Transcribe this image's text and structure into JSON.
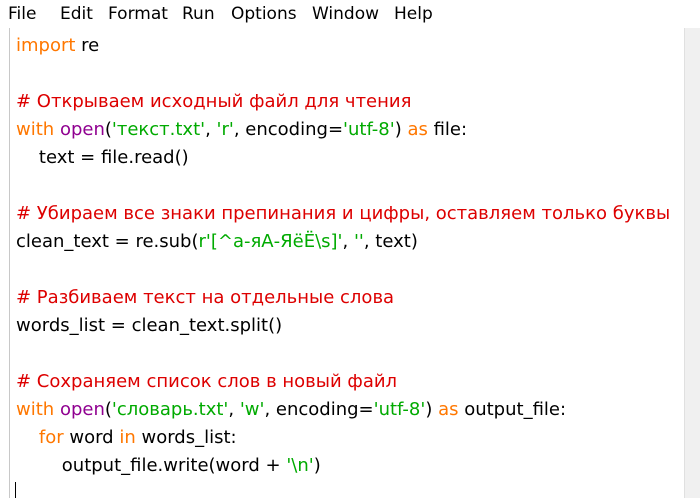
{
  "menu": {
    "items": [
      "File",
      "Edit",
      "Format",
      "Run",
      "Options",
      "Window",
      "Help"
    ]
  },
  "editor": {
    "lines": [
      {
        "tokens": [
          {
            "t": "kw",
            "v": "import"
          },
          {
            "t": "txt",
            "v": " re"
          }
        ]
      },
      {
        "tokens": []
      },
      {
        "tokens": [
          {
            "t": "cm",
            "v": "# Открываем исходный файл для чтения"
          }
        ]
      },
      {
        "tokens": [
          {
            "t": "kw",
            "v": "with"
          },
          {
            "t": "txt",
            "v": " "
          },
          {
            "t": "bi",
            "v": "open"
          },
          {
            "t": "txt",
            "v": "("
          },
          {
            "t": "str",
            "v": "'текст.txt'"
          },
          {
            "t": "txt",
            "v": ", "
          },
          {
            "t": "str",
            "v": "'r'"
          },
          {
            "t": "txt",
            "v": ", encoding="
          },
          {
            "t": "str",
            "v": "'utf-8'"
          },
          {
            "t": "txt",
            "v": ") "
          },
          {
            "t": "kw",
            "v": "as"
          },
          {
            "t": "txt",
            "v": " file:"
          }
        ]
      },
      {
        "tokens": [
          {
            "t": "txt",
            "v": "    text = file.read()"
          }
        ]
      },
      {
        "tokens": []
      },
      {
        "tokens": [
          {
            "t": "cm",
            "v": "# Убираем все знаки препинания и цифры, оставляем только буквы"
          }
        ]
      },
      {
        "tokens": [
          {
            "t": "txt",
            "v": "clean_text = re.sub("
          },
          {
            "t": "str",
            "v": "r'[^а-яА-ЯёЁ\\s]'"
          },
          {
            "t": "txt",
            "v": ", "
          },
          {
            "t": "str",
            "v": "''"
          },
          {
            "t": "txt",
            "v": ", text)"
          }
        ]
      },
      {
        "tokens": []
      },
      {
        "tokens": [
          {
            "t": "cm",
            "v": "# Разбиваем текст на отдельные слова"
          }
        ]
      },
      {
        "tokens": [
          {
            "t": "txt",
            "v": "words_list = clean_text.split()"
          }
        ]
      },
      {
        "tokens": []
      },
      {
        "tokens": [
          {
            "t": "cm",
            "v": "# Сохраняем список слов в новый файл"
          }
        ]
      },
      {
        "tokens": [
          {
            "t": "kw",
            "v": "with"
          },
          {
            "t": "txt",
            "v": " "
          },
          {
            "t": "bi",
            "v": "open"
          },
          {
            "t": "txt",
            "v": "("
          },
          {
            "t": "str",
            "v": "'словарь.txt'"
          },
          {
            "t": "txt",
            "v": ", "
          },
          {
            "t": "str",
            "v": "'w'"
          },
          {
            "t": "txt",
            "v": ", encoding="
          },
          {
            "t": "str",
            "v": "'utf-8'"
          },
          {
            "t": "txt",
            "v": ") "
          },
          {
            "t": "kw",
            "v": "as"
          },
          {
            "t": "txt",
            "v": " output_file:"
          }
        ]
      },
      {
        "tokens": [
          {
            "t": "txt",
            "v": "    "
          },
          {
            "t": "kw",
            "v": "for"
          },
          {
            "t": "txt",
            "v": " word "
          },
          {
            "t": "kw",
            "v": "in"
          },
          {
            "t": "txt",
            "v": " words_list:"
          }
        ]
      },
      {
        "tokens": [
          {
            "t": "txt",
            "v": "        output_file.write(word + "
          },
          {
            "t": "str",
            "v": "'\\n'"
          },
          {
            "t": "txt",
            "v": ")"
          }
        ]
      }
    ]
  },
  "colors": {
    "keyword": "#ff7700",
    "builtin": "#900090",
    "string": "#00aa00",
    "comment": "#dd0000",
    "text": "#000000"
  }
}
